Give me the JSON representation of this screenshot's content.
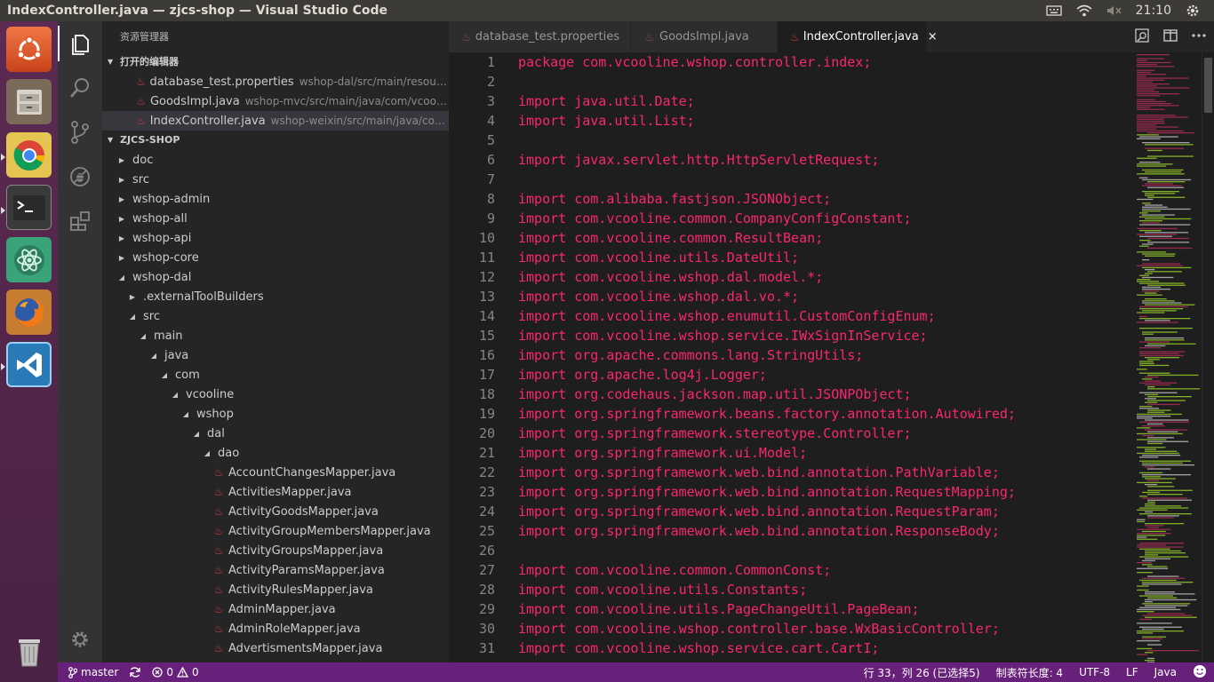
{
  "window": {
    "title": "IndexController.java — zjcs-shop — Visual Studio Code"
  },
  "tray": {
    "clock": "21:10",
    "icons": [
      "keyboard-icon",
      "wifi-icon",
      "volume-muted-icon",
      "gear-icon"
    ]
  },
  "launcher": {
    "apps": [
      "ubuntu-dash-icon",
      "files-icon",
      "chrome-icon",
      "terminal-icon",
      "atom-icon",
      "firefox-icon",
      "vscode-icon",
      "trash-icon"
    ]
  },
  "activitybar": {
    "items": [
      "explorer-icon",
      "search-icon",
      "source-control-icon",
      "debug-icon",
      "extensions-icon",
      "settings-icon"
    ]
  },
  "sidebar": {
    "title": "资源管理器",
    "open_editors_header": "打开的编辑器",
    "open_editors": [
      {
        "name": "database_test.properties",
        "path": "wshop-dal/src/main/resources/W..."
      },
      {
        "name": "GoodsImpl.java",
        "path": "wshop-mvc/src/main/java/com/vcooline/ws..."
      },
      {
        "name": "IndexController.java",
        "path": "wshop-weixin/src/main/java/com/vcoo..."
      }
    ],
    "project_header": "ZJCS-SHOP",
    "tree": [
      {
        "label": "doc",
        "depth": 0,
        "state": "closed",
        "file": false
      },
      {
        "label": "src",
        "depth": 0,
        "state": "closed",
        "file": false
      },
      {
        "label": "wshop-admin",
        "depth": 0,
        "state": "closed",
        "file": false
      },
      {
        "label": "wshop-all",
        "depth": 0,
        "state": "closed",
        "file": false
      },
      {
        "label": "wshop-api",
        "depth": 0,
        "state": "closed",
        "file": false
      },
      {
        "label": "wshop-core",
        "depth": 0,
        "state": "closed",
        "file": false
      },
      {
        "label": "wshop-dal",
        "depth": 0,
        "state": "open",
        "file": false
      },
      {
        "label": ".externalToolBuilders",
        "depth": 1,
        "state": "closed",
        "file": false
      },
      {
        "label": "src",
        "depth": 1,
        "state": "open",
        "file": false
      },
      {
        "label": "main",
        "depth": 2,
        "state": "open",
        "file": false
      },
      {
        "label": "java",
        "depth": 3,
        "state": "open",
        "file": false
      },
      {
        "label": "com",
        "depth": 4,
        "state": "open",
        "file": false
      },
      {
        "label": "vcooline",
        "depth": 5,
        "state": "open",
        "file": false
      },
      {
        "label": "wshop",
        "depth": 6,
        "state": "open",
        "file": false
      },
      {
        "label": "dal",
        "depth": 7,
        "state": "open",
        "file": false
      },
      {
        "label": "dao",
        "depth": 8,
        "state": "open",
        "file": false
      },
      {
        "label": "AccountChangesMapper.java",
        "depth": 9,
        "state": "",
        "file": true
      },
      {
        "label": "ActivitiesMapper.java",
        "depth": 9,
        "state": "",
        "file": true
      },
      {
        "label": "ActivityGoodsMapper.java",
        "depth": 9,
        "state": "",
        "file": true
      },
      {
        "label": "ActivityGroupMembersMapper.java",
        "depth": 9,
        "state": "",
        "file": true
      },
      {
        "label": "ActivityGroupsMapper.java",
        "depth": 9,
        "state": "",
        "file": true
      },
      {
        "label": "ActivityParamsMapper.java",
        "depth": 9,
        "state": "",
        "file": true
      },
      {
        "label": "ActivityRulesMapper.java",
        "depth": 9,
        "state": "",
        "file": true
      },
      {
        "label": "AdminMapper.java",
        "depth": 9,
        "state": "",
        "file": true
      },
      {
        "label": "AdminRoleMapper.java",
        "depth": 9,
        "state": "",
        "file": true
      },
      {
        "label": "AdvertismentsMapper.java",
        "depth": 9,
        "state": "",
        "file": true
      }
    ]
  },
  "tabs": [
    {
      "label": "database_test.properties",
      "active": false
    },
    {
      "label": "GoodsImpl.java",
      "active": false
    },
    {
      "label": "IndexController.java",
      "active": true,
      "close": "×"
    }
  ],
  "editor": {
    "lines": [
      {
        "n": "1",
        "t": "package com.vcooline.wshop.controller.index;"
      },
      {
        "n": "2",
        "t": ""
      },
      {
        "n": "3",
        "t": "import java.util.Date;"
      },
      {
        "n": "4",
        "t": "import java.util.List;"
      },
      {
        "n": "5",
        "t": ""
      },
      {
        "n": "6",
        "t": "import javax.servlet.http.HttpServletRequest;"
      },
      {
        "n": "7",
        "t": ""
      },
      {
        "n": "8",
        "t": "import com.alibaba.fastjson.JSONObject;"
      },
      {
        "n": "9",
        "t": "import com.vcooline.common.CompanyConfigConstant;"
      },
      {
        "n": "10",
        "t": "import com.vcooline.common.ResultBean;"
      },
      {
        "n": "11",
        "t": "import com.vcooline.utils.DateUtil;"
      },
      {
        "n": "12",
        "t": "import com.vcooline.wshop.dal.model.*;"
      },
      {
        "n": "13",
        "t": "import com.vcooline.wshop.dal.vo.*;"
      },
      {
        "n": "14",
        "t": "import com.vcooline.wshop.enumutil.CustomConfigEnum;"
      },
      {
        "n": "15",
        "t": "import com.vcooline.wshop.service.IWxSignInService;"
      },
      {
        "n": "16",
        "t": "import org.apache.commons.lang.StringUtils;"
      },
      {
        "n": "17",
        "t": "import org.apache.log4j.Logger;"
      },
      {
        "n": "18",
        "t": "import org.codehaus.jackson.map.util.JSONPObject;"
      },
      {
        "n": "19",
        "t": "import org.springframework.beans.factory.annotation.Autowired;"
      },
      {
        "n": "20",
        "t": "import org.springframework.stereotype.Controller;"
      },
      {
        "n": "21",
        "t": "import org.springframework.ui.Model;"
      },
      {
        "n": "22",
        "t": "import org.springframework.web.bind.annotation.PathVariable;"
      },
      {
        "n": "23",
        "t": "import org.springframework.web.bind.annotation.RequestMapping;"
      },
      {
        "n": "24",
        "t": "import org.springframework.web.bind.annotation.RequestParam;"
      },
      {
        "n": "25",
        "t": "import org.springframework.web.bind.annotation.ResponseBody;"
      },
      {
        "n": "26",
        "t": ""
      },
      {
        "n": "27",
        "t": "import com.vcooline.common.CommonConst;"
      },
      {
        "n": "28",
        "t": "import com.vcooline.utils.Constants;"
      },
      {
        "n": "29",
        "t": "import com.vcooline.utils.PageChangeUtil.PageBean;"
      },
      {
        "n": "30",
        "t": "import com.vcooline.wshop.controller.base.WxBasicController;"
      },
      {
        "n": "31",
        "t": "import com.vcooline.wshop.service.cart.CartI;"
      }
    ]
  },
  "statusbar": {
    "branch": "master",
    "errors": "0",
    "warnings": "0",
    "position": "行 33，列 26 (已选择5)",
    "tab_size": "制表符长度: 4",
    "encoding": "UTF-8",
    "eol": "LF",
    "language": "Java"
  },
  "colors": {
    "statusbar": "#68217a",
    "keyword": "#f92672",
    "launcher": "#5e2750"
  }
}
